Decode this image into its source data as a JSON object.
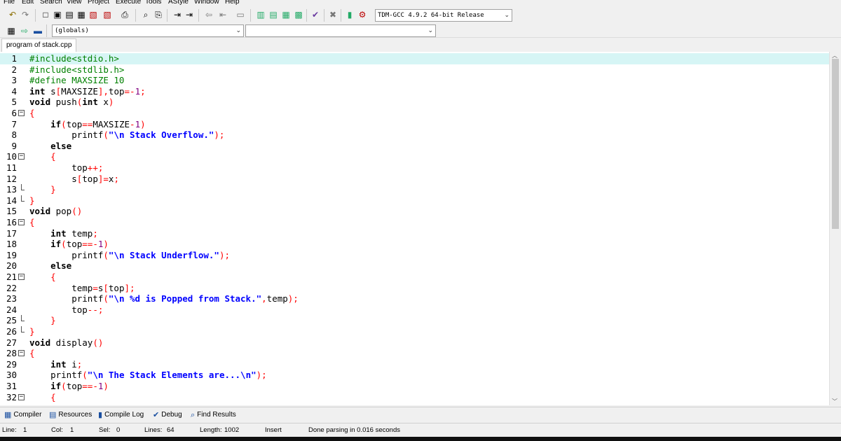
{
  "menu": [
    "File",
    "Edit",
    "Search",
    "View",
    "Project",
    "Execute",
    "Tools",
    "AStyle",
    "Window",
    "Help"
  ],
  "toolbar": {
    "compiler_select": "TDM-GCC 4.9.2 64-bit Release",
    "scope_select": "(globals)",
    "symbol_select": ""
  },
  "icons": {
    "undo": "↶",
    "redo": "↷",
    "new": "□",
    "open": "▣",
    "save": "▤",
    "save_all": "▦",
    "close": "▧",
    "print": "⎙",
    "find": "⌕",
    "replace": "⎘",
    "goto": "⇥",
    "indent": "⇤",
    "unindent": "⇦",
    "toggle_comment": "▭",
    "compile": "▥",
    "run": "▤",
    "compile_run": "▦",
    "rebuild": "▩",
    "check": "✔",
    "stop": "✖",
    "chart": "▮",
    "debug": "⚙",
    "class_browser": "▦",
    "insert": "⇨",
    "bookmark": "▬"
  },
  "file_tab": "program of stack.cpp",
  "code_lines": [
    {
      "n": "1",
      "fold": "",
      "tokens": [
        {
          "t": "#include<stdio.h>",
          "c": "pre"
        }
      ]
    },
    {
      "n": "2",
      "fold": "",
      "tokens": [
        {
          "t": "#include<stdlib.h>",
          "c": "pre"
        }
      ]
    },
    {
      "n": "3",
      "fold": "",
      "tokens": [
        {
          "t": "#define MAXSIZE 10",
          "c": "pre"
        }
      ]
    },
    {
      "n": "4",
      "fold": "",
      "tokens": [
        {
          "t": "int",
          "c": "kw"
        },
        {
          "t": " s",
          "c": ""
        },
        {
          "t": "[",
          "c": "sym"
        },
        {
          "t": "MAXSIZE",
          "c": ""
        },
        {
          "t": "],",
          "c": "sym"
        },
        {
          "t": "top",
          "c": ""
        },
        {
          "t": "=-",
          "c": "sym"
        },
        {
          "t": "1",
          "c": "num"
        },
        {
          "t": ";",
          "c": "sym"
        }
      ]
    },
    {
      "n": "5",
      "fold": "",
      "tokens": [
        {
          "t": "void",
          "c": "kw"
        },
        {
          "t": " push",
          "c": ""
        },
        {
          "t": "(",
          "c": "sym"
        },
        {
          "t": "int",
          "c": "kw"
        },
        {
          "t": " x",
          "c": ""
        },
        {
          "t": ")",
          "c": "sym"
        }
      ]
    },
    {
      "n": "6",
      "fold": "open",
      "tokens": [
        {
          "t": "{",
          "c": "sym"
        }
      ]
    },
    {
      "n": "7",
      "fold": "",
      "tokens": [
        {
          "t": "    ",
          "c": ""
        },
        {
          "t": "if",
          "c": "kw"
        },
        {
          "t": "(",
          "c": "sym"
        },
        {
          "t": "top",
          "c": ""
        },
        {
          "t": "==",
          "c": "sym"
        },
        {
          "t": "MAXSIZE",
          "c": ""
        },
        {
          "t": "-",
          "c": "sym"
        },
        {
          "t": "1",
          "c": "num"
        },
        {
          "t": ")",
          "c": "sym"
        }
      ]
    },
    {
      "n": "8",
      "fold": "",
      "tokens": [
        {
          "t": "        printf",
          "c": ""
        },
        {
          "t": "(",
          "c": "sym"
        },
        {
          "t": "\"\\n Stack Overflow.\"",
          "c": "str"
        },
        {
          "t": ");",
          "c": "sym"
        }
      ]
    },
    {
      "n": "9",
      "fold": "",
      "tokens": [
        {
          "t": "    ",
          "c": ""
        },
        {
          "t": "else",
          "c": "kw"
        }
      ]
    },
    {
      "n": "10",
      "fold": "open",
      "tokens": [
        {
          "t": "    ",
          "c": ""
        },
        {
          "t": "{",
          "c": "sym"
        }
      ]
    },
    {
      "n": "11",
      "fold": "",
      "tokens": [
        {
          "t": "        top",
          "c": ""
        },
        {
          "t": "++;",
          "c": "sym"
        }
      ]
    },
    {
      "n": "12",
      "fold": "",
      "tokens": [
        {
          "t": "        s",
          "c": ""
        },
        {
          "t": "[",
          "c": "sym"
        },
        {
          "t": "top",
          "c": ""
        },
        {
          "t": "]=",
          "c": "sym"
        },
        {
          "t": "x",
          "c": ""
        },
        {
          "t": ";",
          "c": "sym"
        }
      ]
    },
    {
      "n": "13",
      "fold": "end",
      "tokens": [
        {
          "t": "    ",
          "c": ""
        },
        {
          "t": "}",
          "c": "sym"
        }
      ]
    },
    {
      "n": "14",
      "fold": "end",
      "tokens": [
        {
          "t": "}",
          "c": "sym"
        }
      ]
    },
    {
      "n": "15",
      "fold": "",
      "tokens": [
        {
          "t": "void",
          "c": "kw"
        },
        {
          "t": " pop",
          "c": ""
        },
        {
          "t": "()",
          "c": "sym"
        }
      ]
    },
    {
      "n": "16",
      "fold": "open",
      "tokens": [
        {
          "t": "{",
          "c": "sym"
        }
      ]
    },
    {
      "n": "17",
      "fold": "",
      "tokens": [
        {
          "t": "    ",
          "c": ""
        },
        {
          "t": "int",
          "c": "kw"
        },
        {
          "t": " temp",
          "c": ""
        },
        {
          "t": ";",
          "c": "sym"
        }
      ]
    },
    {
      "n": "18",
      "fold": "",
      "tokens": [
        {
          "t": "    ",
          "c": ""
        },
        {
          "t": "if",
          "c": "kw"
        },
        {
          "t": "(",
          "c": "sym"
        },
        {
          "t": "top",
          "c": ""
        },
        {
          "t": "==-",
          "c": "sym"
        },
        {
          "t": "1",
          "c": "num"
        },
        {
          "t": ")",
          "c": "sym"
        }
      ]
    },
    {
      "n": "19",
      "fold": "",
      "tokens": [
        {
          "t": "        printf",
          "c": ""
        },
        {
          "t": "(",
          "c": "sym"
        },
        {
          "t": "\"\\n Stack Underflow.\"",
          "c": "str"
        },
        {
          "t": ");",
          "c": "sym"
        }
      ]
    },
    {
      "n": "20",
      "fold": "",
      "tokens": [
        {
          "t": "    ",
          "c": ""
        },
        {
          "t": "else",
          "c": "kw"
        }
      ]
    },
    {
      "n": "21",
      "fold": "open",
      "tokens": [
        {
          "t": "    ",
          "c": ""
        },
        {
          "t": "{",
          "c": "sym"
        }
      ]
    },
    {
      "n": "22",
      "fold": "",
      "tokens": [
        {
          "t": "        temp",
          "c": ""
        },
        {
          "t": "=",
          "c": "sym"
        },
        {
          "t": "s",
          "c": ""
        },
        {
          "t": "[",
          "c": "sym"
        },
        {
          "t": "top",
          "c": ""
        },
        {
          "t": "];",
          "c": "sym"
        }
      ]
    },
    {
      "n": "23",
      "fold": "",
      "tokens": [
        {
          "t": "        printf",
          "c": ""
        },
        {
          "t": "(",
          "c": "sym"
        },
        {
          "t": "\"\\n %d is Popped from Stack.\"",
          "c": "str"
        },
        {
          "t": ",",
          "c": "sym"
        },
        {
          "t": "temp",
          "c": ""
        },
        {
          "t": ");",
          "c": "sym"
        }
      ]
    },
    {
      "n": "24",
      "fold": "",
      "tokens": [
        {
          "t": "        top",
          "c": ""
        },
        {
          "t": "--;",
          "c": "sym"
        }
      ]
    },
    {
      "n": "25",
      "fold": "end",
      "tokens": [
        {
          "t": "    ",
          "c": ""
        },
        {
          "t": "}",
          "c": "sym"
        }
      ]
    },
    {
      "n": "26",
      "fold": "end",
      "tokens": [
        {
          "t": "}",
          "c": "sym"
        }
      ]
    },
    {
      "n": "27",
      "fold": "",
      "tokens": [
        {
          "t": "void",
          "c": "kw"
        },
        {
          "t": " display",
          "c": ""
        },
        {
          "t": "()",
          "c": "sym"
        }
      ]
    },
    {
      "n": "28",
      "fold": "open",
      "tokens": [
        {
          "t": "{",
          "c": "sym"
        }
      ]
    },
    {
      "n": "29",
      "fold": "",
      "tokens": [
        {
          "t": "    ",
          "c": ""
        },
        {
          "t": "int",
          "c": "kw"
        },
        {
          "t": " i",
          "c": ""
        },
        {
          "t": ";",
          "c": "sym"
        }
      ]
    },
    {
      "n": "30",
      "fold": "",
      "tokens": [
        {
          "t": "    printf",
          "c": ""
        },
        {
          "t": "(",
          "c": "sym"
        },
        {
          "t": "\"\\n The Stack Elements are...\\n\"",
          "c": "str"
        },
        {
          "t": ");",
          "c": "sym"
        }
      ]
    },
    {
      "n": "31",
      "fold": "",
      "tokens": [
        {
          "t": "    ",
          "c": ""
        },
        {
          "t": "if",
          "c": "kw"
        },
        {
          "t": "(",
          "c": "sym"
        },
        {
          "t": "top",
          "c": ""
        },
        {
          "t": "==-",
          "c": "sym"
        },
        {
          "t": "1",
          "c": "num"
        },
        {
          "t": ")",
          "c": "sym"
        }
      ]
    },
    {
      "n": "32",
      "fold": "open",
      "tokens": [
        {
          "t": "    ",
          "c": ""
        },
        {
          "t": "{",
          "c": "sym"
        }
      ]
    }
  ],
  "bottom_tabs": [
    {
      "label": "Compiler",
      "icon": "compiler-icon"
    },
    {
      "label": "Resources",
      "icon": "resources-icon"
    },
    {
      "label": "Compile Log",
      "icon": "compile-log-icon"
    },
    {
      "label": "Debug",
      "icon": "debug-icon"
    },
    {
      "label": "Find Results",
      "icon": "find-results-icon"
    }
  ],
  "status": {
    "line_label": "Line:",
    "line_value": "1",
    "col_label": "Col:",
    "col_value": "1",
    "sel_label": "Sel:",
    "sel_value": "0",
    "lines_label": "Lines:",
    "lines_value": "64",
    "length_label": "Length:",
    "length_value": "1002",
    "mode": "Insert",
    "message": "Done parsing in 0.016 seconds"
  },
  "colors": {
    "preprocessor": "#008000",
    "string": "#0000ff",
    "symbol": "#ff0000",
    "number": "#800080",
    "current_line": "#d6f5f5"
  }
}
